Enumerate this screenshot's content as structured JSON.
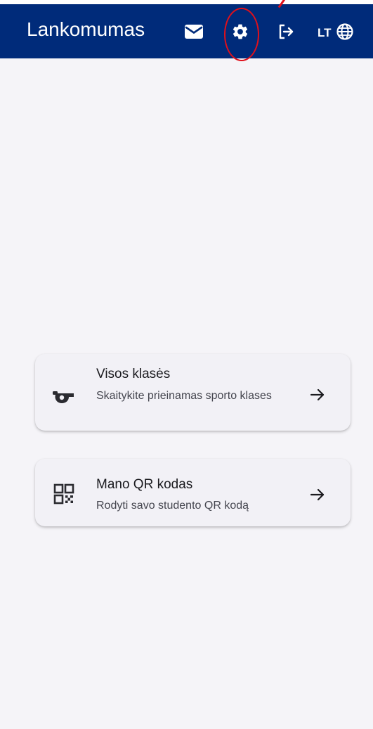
{
  "appbar": {
    "title": "Lankomumas",
    "background": "#002b7a",
    "icons": {
      "mail": "mail-icon",
      "settings": "gear-icon",
      "logout": "logout-icon",
      "language": "globe-icon"
    },
    "language_code": "LT"
  },
  "cards": [
    {
      "icon": "whistle-icon",
      "title": "Visos klasės",
      "subtitle": "Skaitykite prieinamas sporto klases",
      "arrow": "arrow-right-icon"
    },
    {
      "icon": "qr-code-icon",
      "title": "Mano QR kodas",
      "subtitle": "Rodyti savo studento QR kodą",
      "arrow": "arrow-right-icon"
    }
  ],
  "annotation": {
    "color": "#e0101b",
    "target": "settings"
  }
}
